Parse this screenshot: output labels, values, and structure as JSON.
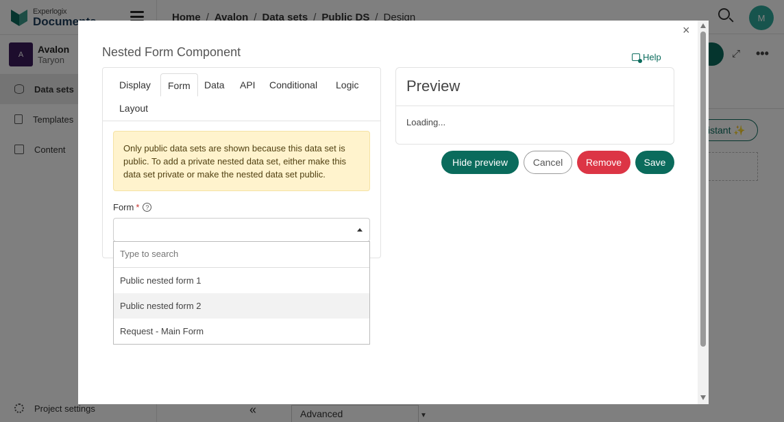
{
  "app": {
    "logo_line1": "Experlogix",
    "logo_line2": "Documents",
    "project_initial": "A",
    "project_name": "Avalon",
    "project_user": "Taryon",
    "nav": [
      {
        "label": "Data sets"
      },
      {
        "label": "Templates"
      },
      {
        "label": "Content"
      }
    ],
    "project_settings": "Project settings",
    "breadcrumbs": [
      "Home",
      "Avalon",
      "Data sets",
      "Public DS",
      "Design"
    ],
    "user_initial": "M",
    "bg_assistant": "istant ✨",
    "bg_advanced": "Advanced"
  },
  "modal": {
    "title": "Nested Form Component",
    "help_label": "Help",
    "tabs": [
      "Display",
      "Form",
      "Data",
      "API",
      "Conditional",
      "Logic",
      "Layout"
    ],
    "active_tab": "Form",
    "alert_text": "Only public data sets are shown because this data set is public. To add a private nested data set, either make this data set private or make the nested data set public.",
    "form_label": "Form",
    "required_mark": "*",
    "help_mark": "?",
    "select_value": "",
    "dropdown": {
      "search_placeholder": "Type to search",
      "options": [
        "Public nested form 1",
        "Public nested form 2",
        "Request - Main Form"
      ],
      "highlighted": "Public nested form 2"
    },
    "preview": {
      "title": "Preview",
      "body": "Loading..."
    },
    "buttons": {
      "hide_preview": "Hide preview",
      "cancel": "Cancel",
      "remove": "Remove",
      "save": "Save"
    },
    "close_symbol": "×"
  }
}
